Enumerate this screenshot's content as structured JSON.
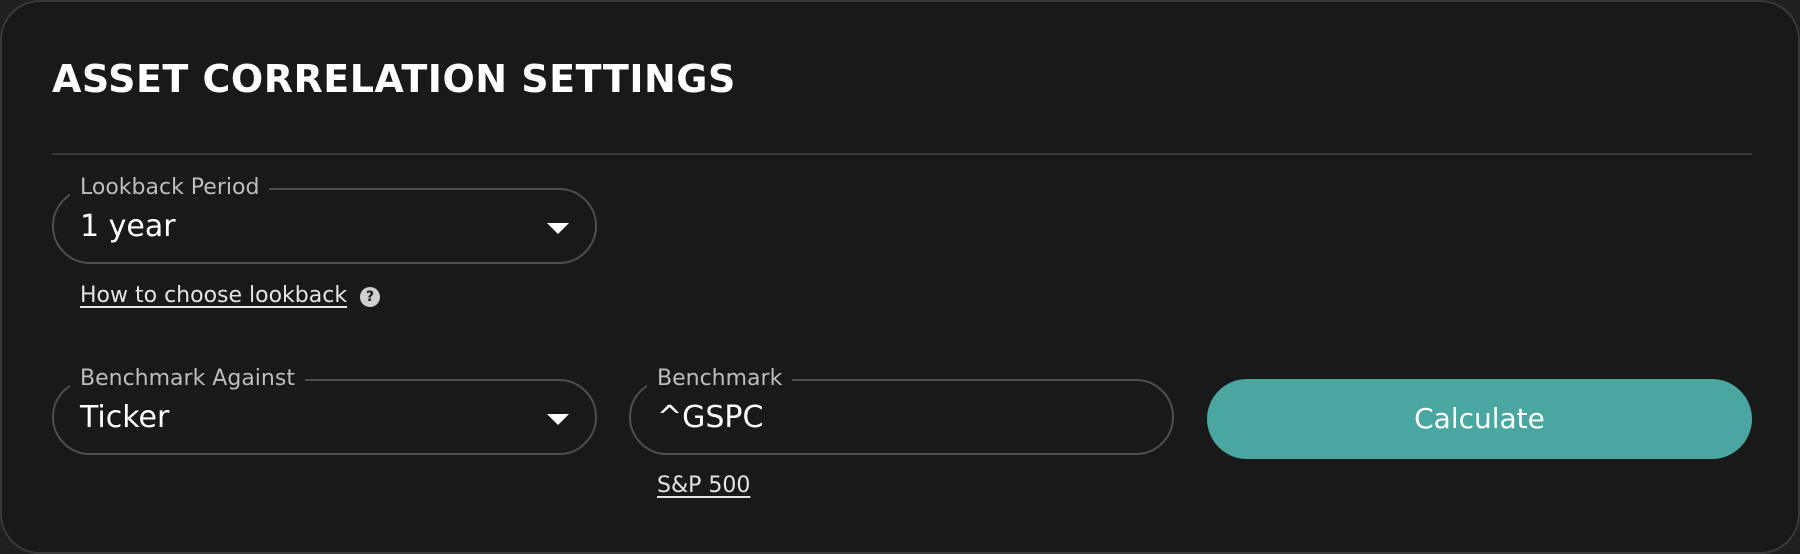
{
  "panel": {
    "title": "ASSET CORRELATION SETTINGS"
  },
  "lookback": {
    "label": "Lookback Period",
    "value": "1 year",
    "help_link": "How to choose lookback",
    "help_icon": "question-circle-icon"
  },
  "benchmark_against": {
    "label": "Benchmark Against",
    "value": "Ticker"
  },
  "benchmark": {
    "label": "Benchmark",
    "value": "^GSPC",
    "name_link": "S&P 500"
  },
  "actions": {
    "calculate_label": "Calculate"
  },
  "colors": {
    "background": "#191919",
    "border": "#4e4e4e",
    "accent": "#4aa6a0",
    "text": "#ffffff",
    "muted_text": "#bdbdbd"
  }
}
